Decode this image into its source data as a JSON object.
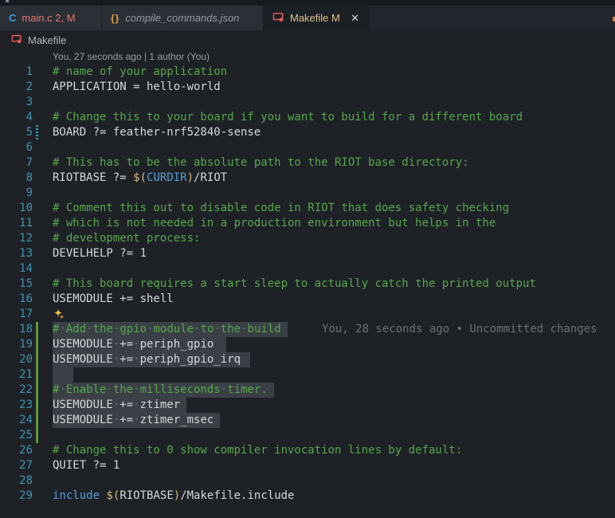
{
  "tabs": [
    {
      "label": "main.c 2, M",
      "icon": "c-language-icon",
      "icon_glyph": "C",
      "icon_color": "#3b9ddd",
      "text_color": "#e5736d",
      "state": "inactive"
    },
    {
      "label": "compile_commands.json",
      "icon": "json-braces-icon",
      "icon_glyph": "{}",
      "icon_color": "#dfa63f",
      "text_color": "#9599a0",
      "state": "preview"
    },
    {
      "label": "Makefile M",
      "icon": "makefile-icon",
      "icon_color": "#e45e5a",
      "text_color": "#ddc18f",
      "state": "active",
      "close_glyph": "✕"
    }
  ],
  "breadcrumb": {
    "label": "Makefile",
    "icon": "makefile-icon"
  },
  "codelens": {
    "text": "You, 27 seconds ago | 1 author (You)"
  },
  "editor": {
    "language": "makefile",
    "lines": [
      {
        "n": 1,
        "seg": [
          [
            "comment",
            "# name of your application"
          ]
        ]
      },
      {
        "n": 2,
        "seg": [
          [
            "plain",
            "APPLICATION = hello-world"
          ]
        ]
      },
      {
        "n": 3,
        "seg": []
      },
      {
        "n": 4,
        "seg": [
          [
            "comment",
            "# Change this to your board if you want to build for a different board"
          ]
        ]
      },
      {
        "n": 5,
        "seg": [
          [
            "plain",
            "BOARD ?= feather-nrf52840-sense"
          ]
        ],
        "gutter": "modified"
      },
      {
        "n": 6,
        "seg": []
      },
      {
        "n": 7,
        "seg": [
          [
            "comment",
            "# This has to be the absolute path to the RIOT base directory:"
          ]
        ]
      },
      {
        "n": 8,
        "seg": [
          [
            "plain",
            "RIOTBASE ?= "
          ],
          [
            "yellow",
            "$("
          ],
          [
            "blue",
            "CURDIR"
          ],
          [
            "yellow",
            ")"
          ],
          [
            "plain",
            "/RIOT"
          ]
        ]
      },
      {
        "n": 9,
        "seg": []
      },
      {
        "n": 10,
        "seg": [
          [
            "comment",
            "# Comment this out to disable code in RIOT that does safety checking"
          ]
        ]
      },
      {
        "n": 11,
        "seg": [
          [
            "comment",
            "# which is not needed in a production environment but helps in the"
          ]
        ]
      },
      {
        "n": 12,
        "seg": [
          [
            "comment",
            "# development process:"
          ]
        ]
      },
      {
        "n": 13,
        "seg": [
          [
            "plain",
            "DEVELHELP ?= 1"
          ]
        ]
      },
      {
        "n": 14,
        "seg": []
      },
      {
        "n": 15,
        "seg": [
          [
            "comment",
            "# This board requires a start sleep to actually catch the printed output"
          ]
        ]
      },
      {
        "n": 16,
        "seg": [
          [
            "plain",
            "USEMODULE += shell"
          ]
        ]
      },
      {
        "n": 17,
        "seg": [],
        "sparkle": true
      },
      {
        "n": 18,
        "seg": [
          [
            "comment",
            "# Add the gpio module to the build"
          ]
        ],
        "sel": true,
        "sel_extra": 8,
        "gutter": "added",
        "blame": "You, 28 seconds ago • Uncommitted changes"
      },
      {
        "n": 19,
        "seg": [
          [
            "plain",
            "USEMODULE += periph_gpio"
          ]
        ],
        "sel": true,
        "sel_extra": 16,
        "gutter": "added"
      },
      {
        "n": 20,
        "seg": [
          [
            "plain",
            "USEMODULE += periph_gpio_irq"
          ]
        ],
        "sel": true,
        "sel_extra": 12,
        "gutter": "added"
      },
      {
        "n": 21,
        "seg": [],
        "sel": true,
        "sel_width": 26,
        "gutter": "added"
      },
      {
        "n": 22,
        "seg": [
          [
            "comment",
            "# Enable the milliseconds timer."
          ]
        ],
        "sel": true,
        "sel_extra": 8,
        "gutter": "added"
      },
      {
        "n": 23,
        "seg": [
          [
            "plain",
            "USEMODULE += ztimer"
          ]
        ],
        "sel": true,
        "sel_extra": 8,
        "gutter": "added"
      },
      {
        "n": 24,
        "seg": [
          [
            "plain",
            "USEMODULE += ztimer_msec"
          ]
        ],
        "sel": true,
        "sel_extra": 8,
        "gutter": "added"
      },
      {
        "n": 25,
        "seg": [],
        "gutter": "added"
      },
      {
        "n": 26,
        "seg": [
          [
            "comment",
            "# Change this to 0 show compiler invocation lines by default:"
          ]
        ]
      },
      {
        "n": 27,
        "seg": [
          [
            "plain",
            "QUIET ?= 1"
          ]
        ]
      },
      {
        "n": 28,
        "seg": []
      },
      {
        "n": 29,
        "seg": [
          [
            "blue",
            "include"
          ],
          [
            "plain",
            " "
          ],
          [
            "yellow",
            "$("
          ],
          [
            "plain",
            "RIOTBASE"
          ],
          [
            "yellow",
            ")"
          ],
          [
            "plain",
            "/Makefile.include"
          ]
        ]
      }
    ]
  },
  "colors": {
    "syntax": {
      "comment": "#57a64a",
      "plain": "#d5d7d9",
      "yellow": "#d7ba7d",
      "blue": "#569cd6"
    },
    "line_number": "#4093b0",
    "selection_bg": "#3a4046",
    "git_added_bar": "#5a9c30",
    "git_modified_bar": "#2f9bb5",
    "codelens_text": "#999da3",
    "blame_text": "#6b7076",
    "sparkle_big": "#e8c24a",
    "sparkle_small": "#d29922",
    "whitespace_dot": "#666c73"
  }
}
